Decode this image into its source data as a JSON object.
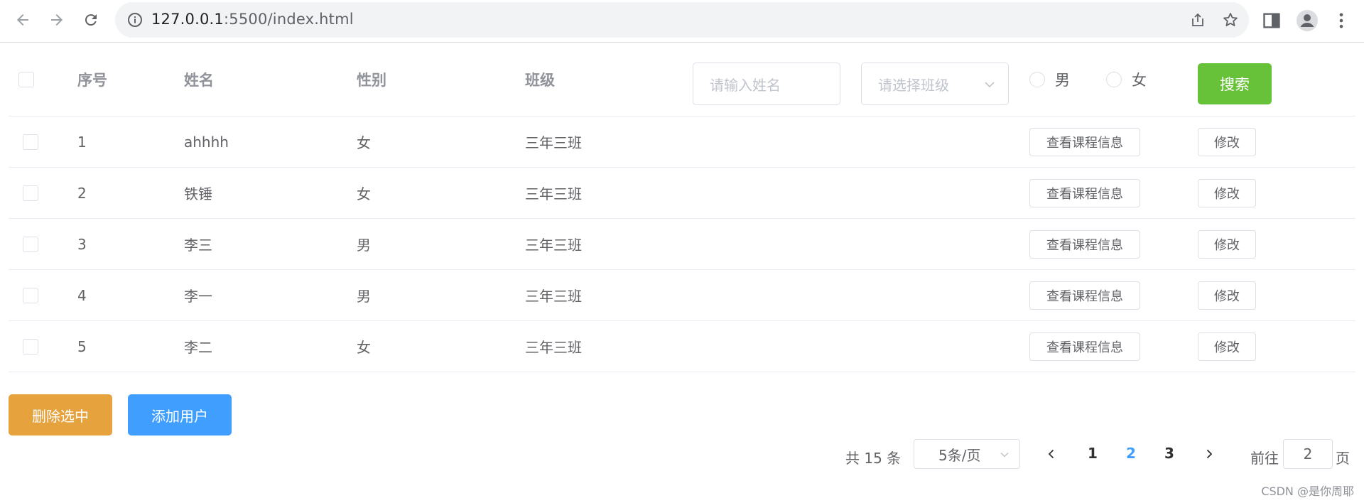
{
  "browser": {
    "url_host": "127.0.0.1",
    "url_rest": ":5500/index.html"
  },
  "table": {
    "headers": {
      "index": "序号",
      "name": "姓名",
      "gender": "性别",
      "class": "班级"
    },
    "filters": {
      "name_placeholder": "请输入姓名",
      "class_placeholder": "请选择班级",
      "gender_male": "男",
      "gender_female": "女",
      "search_label": "搜索"
    },
    "rows": [
      {
        "index": "1",
        "name": "ahhhh",
        "gender": "女",
        "class": "三年三班",
        "view_label": "查看课程信息",
        "edit_label": "修改"
      },
      {
        "index": "2",
        "name": "铁锤",
        "gender": "女",
        "class": "三年三班",
        "view_label": "查看课程信息",
        "edit_label": "修改"
      },
      {
        "index": "3",
        "name": "李三",
        "gender": "男",
        "class": "三年三班",
        "view_label": "查看课程信息",
        "edit_label": "修改"
      },
      {
        "index": "4",
        "name": "李一",
        "gender": "男",
        "class": "三年三班",
        "view_label": "查看课程信息",
        "edit_label": "修改"
      },
      {
        "index": "5",
        "name": "李二",
        "gender": "女",
        "class": "三年三班",
        "view_label": "查看课程信息",
        "edit_label": "修改"
      }
    ]
  },
  "actions": {
    "delete_selected": "删除选中",
    "add_user": "添加用户"
  },
  "pagination": {
    "total_text": "共 15 条",
    "page_size": "5条/页",
    "pages": [
      "1",
      "2",
      "3"
    ],
    "current_page": "2",
    "goto_label": "前往",
    "goto_value": "2",
    "page_suffix": "页"
  },
  "watermark": "CSDN @是你周耶",
  "colors": {
    "success": "#67c23a",
    "warning": "#e6a23c",
    "primary": "#409eff"
  }
}
